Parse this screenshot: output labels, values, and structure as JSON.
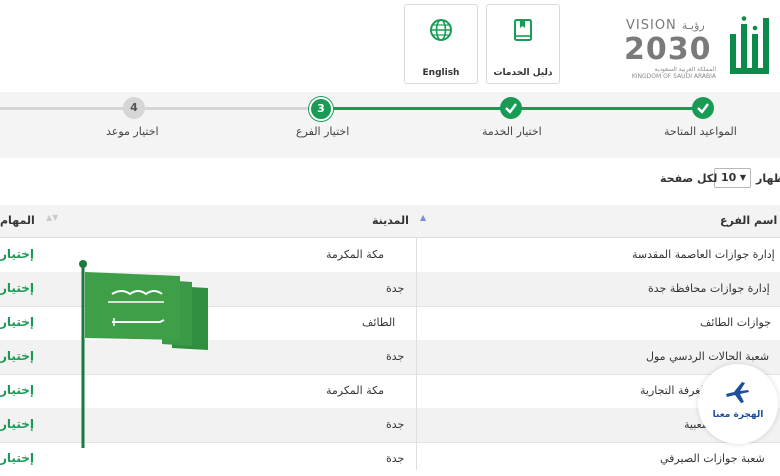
{
  "header": {
    "services_guide_label": "دليل الخدمات",
    "english_label": "English",
    "logo": {
      "vision": "VISION",
      "vision_ar": "رؤيـة",
      "year": "2030",
      "kingdom_ar": "المملكة العربية السعودية",
      "kingdom_en": "KINGDOM OF SAUDI ARABIA"
    }
  },
  "steps": [
    {
      "label": "المواعيد المتاحة",
      "state": "done",
      "number": ""
    },
    {
      "label": "اختيار الخدمة",
      "state": "done",
      "number": ""
    },
    {
      "label": "اختيار الفرع",
      "state": "current",
      "number": "3"
    },
    {
      "label": "اختيار موعد",
      "state": "todo",
      "number": "4"
    }
  ],
  "page_size": {
    "prefix": "إظهار",
    "value": "10",
    "suffix": "لكل صفحة"
  },
  "table": {
    "columns": {
      "branch": "اسم الفرع",
      "city": "المدينة",
      "actions": "المهام"
    },
    "rows": [
      {
        "branch": "إدارة جوازات العاصمة المقدسة",
        "city": "مكة المكرمة",
        "action": "إختيار"
      },
      {
        "branch": "إدارة جوازات محافظة جدة",
        "city": "جدة",
        "action": "إختيار"
      },
      {
        "branch": "جوازات الطائف",
        "city": "الطائف",
        "action": "إختيار"
      },
      {
        "branch": "شعبة الحالات الردسي مول",
        "city": "جدة",
        "action": "إختيار"
      },
      {
        "branch": "الغرفة التجارية",
        "city": "مكة المكرمة",
        "action": "إختيار"
      },
      {
        "branch": "الشعبية",
        "city": "جدة",
        "action": "إختيار"
      },
      {
        "branch": "شعبة جوازات الصيرفي",
        "city": "جدة",
        "action": "إختيار"
      }
    ]
  },
  "badge": {
    "text": "الهجرة معنا"
  },
  "colors": {
    "accent": "#1a9b55",
    "badge_blue": "#1e4e9c"
  },
  "icons": {
    "globe": "globe-icon",
    "book": "book-icon",
    "plane": "plane-icon",
    "check": "check-icon"
  }
}
